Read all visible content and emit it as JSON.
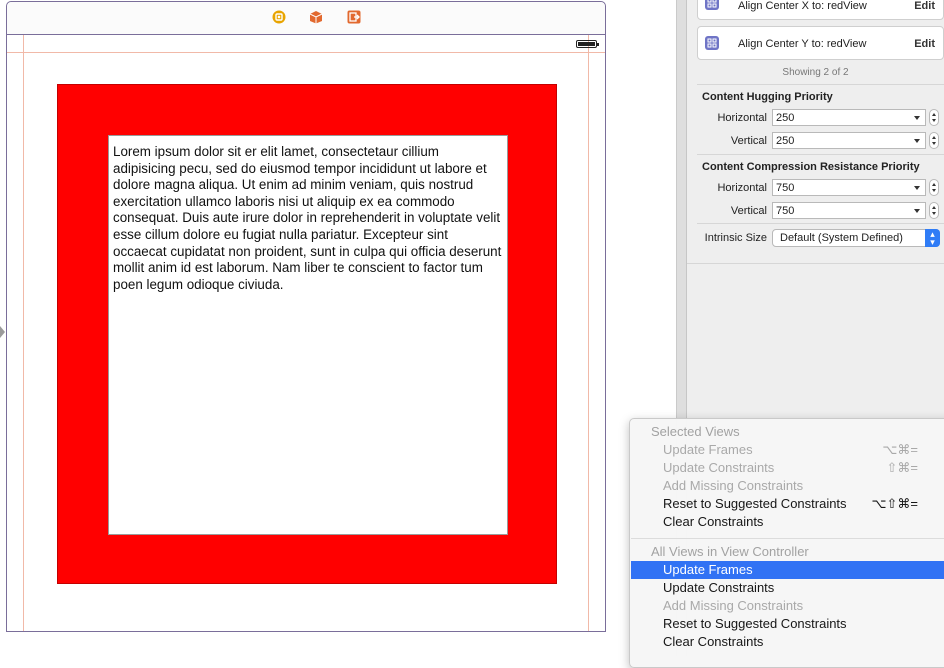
{
  "scene": {
    "text_view_content": "Lorem ipsum dolor sit er elit lamet, consectetaur cillium adipisicing pecu, sed do eiusmod tempor incididunt ut labore et dolore magna aliqua. Ut enim ad minim veniam, quis nostrud exercitation ullamco laboris nisi ut aliquip ex ea commodo consequat. Duis aute irure dolor in reprehenderit in voluptate velit esse cillum dolore eu fugiat nulla pariatur. Excepteur sint occaecat cupidatat non proident, sunt in culpa qui officia deserunt mollit anim id est laborum. Nam liber te conscient to factor tum poen legum odioque civiuda.",
    "red_view_color": "#ff0000",
    "dock_icons": [
      "view-controller-icon",
      "first-responder-icon",
      "exit-icon"
    ],
    "dock_colors": [
      "#e8a400",
      "#e2692f",
      "#e2692f"
    ]
  },
  "inspector": {
    "constraints": [
      {
        "label": "Align Center X to:",
        "target": "redView",
        "edit": "Edit"
      },
      {
        "label": "Align Center Y to:",
        "target": "redView",
        "edit": "Edit"
      }
    ],
    "showing": "Showing 2 of 2",
    "hugging": {
      "title": "Content Hugging Priority",
      "horizontal_label": "Horizontal",
      "horizontal_value": "250",
      "vertical_label": "Vertical",
      "vertical_value": "250"
    },
    "compression": {
      "title": "Content Compression Resistance Priority",
      "horizontal_label": "Horizontal",
      "horizontal_value": "750",
      "vertical_label": "Vertical",
      "vertical_value": "750"
    },
    "intrinsic": {
      "label": "Intrinsic Size",
      "value": "Default (System Defined)"
    }
  },
  "menu": {
    "section1_header": "Selected Views",
    "section1_items": [
      {
        "label": "Update Frames",
        "shortcut": "⌥⌘=",
        "enabled": false
      },
      {
        "label": "Update Constraints",
        "shortcut": "⇧⌘=",
        "enabled": false
      },
      {
        "label": "Add Missing Constraints",
        "shortcut": "",
        "enabled": false
      },
      {
        "label": "Reset to Suggested Constraints",
        "shortcut": "⌥⇧⌘=",
        "enabled": true
      },
      {
        "label": "Clear Constraints",
        "shortcut": "",
        "enabled": true
      }
    ],
    "section2_header": "All Views in View Controller",
    "section2_items": [
      {
        "label": "Update Frames",
        "shortcut": "",
        "enabled": true,
        "selected": true
      },
      {
        "label": "Update Constraints",
        "shortcut": "",
        "enabled": true
      },
      {
        "label": "Add Missing Constraints",
        "shortcut": "",
        "enabled": false
      },
      {
        "label": "Reset to Suggested Constraints",
        "shortcut": "",
        "enabled": true
      },
      {
        "label": "Clear Constraints",
        "shortcut": "",
        "enabled": true
      }
    ]
  }
}
